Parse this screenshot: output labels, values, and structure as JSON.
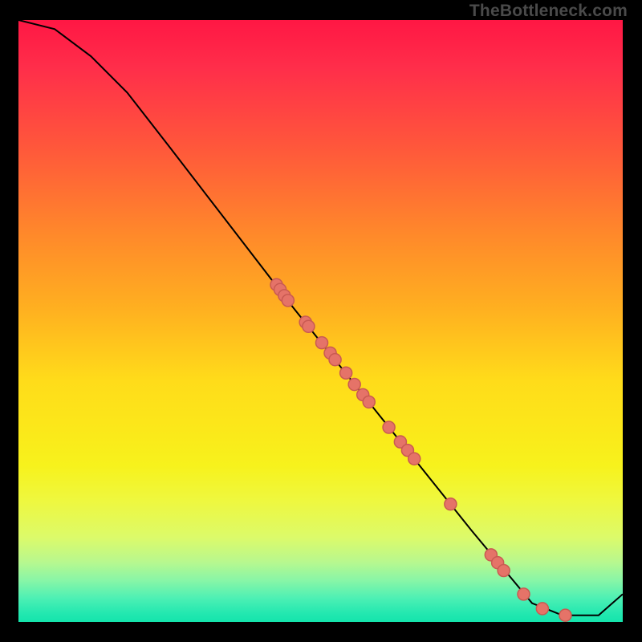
{
  "watermark": "TheBottleneck.com",
  "chart_data": {
    "type": "line",
    "title": "",
    "xlabel": "",
    "ylabel": "",
    "xlim": [
      0,
      100
    ],
    "ylim": [
      0,
      100
    ],
    "curve": [
      {
        "x": 0,
        "y": 100
      },
      {
        "x": 6,
        "y": 98.5
      },
      {
        "x": 12,
        "y": 94
      },
      {
        "x": 18,
        "y": 88
      },
      {
        "x": 25,
        "y": 79
      },
      {
        "x": 35,
        "y": 66
      },
      {
        "x": 45,
        "y": 53
      },
      {
        "x": 55,
        "y": 40.5
      },
      {
        "x": 65,
        "y": 28
      },
      {
        "x": 75,
        "y": 15.5
      },
      {
        "x": 85,
        "y": 3.5
      },
      {
        "x": 90,
        "y": 1.5
      },
      {
        "x": 96,
        "y": 1.5
      },
      {
        "x": 100,
        "y": 5
      }
    ],
    "points": [
      {
        "x": 42.7,
        "y": 56.2,
        "r": 5
      },
      {
        "x": 43.3,
        "y": 55.4,
        "r": 5
      },
      {
        "x": 44.0,
        "y": 54.4,
        "r": 5
      },
      {
        "x": 44.6,
        "y": 53.6,
        "r": 5
      },
      {
        "x": 47.5,
        "y": 50.0,
        "r": 5
      },
      {
        "x": 48.0,
        "y": 49.3,
        "r": 5
      },
      {
        "x": 50.2,
        "y": 46.6,
        "r": 5
      },
      {
        "x": 51.6,
        "y": 44.9,
        "r": 5
      },
      {
        "x": 52.4,
        "y": 43.8,
        "r": 5
      },
      {
        "x": 54.2,
        "y": 41.6,
        "r": 5
      },
      {
        "x": 55.6,
        "y": 39.7,
        "r": 5
      },
      {
        "x": 57.0,
        "y": 38.0,
        "r": 5
      },
      {
        "x": 58.0,
        "y": 36.8,
        "r": 5
      },
      {
        "x": 61.3,
        "y": 32.6,
        "r": 5
      },
      {
        "x": 63.2,
        "y": 30.2,
        "r": 5
      },
      {
        "x": 64.4,
        "y": 28.8,
        "r": 5
      },
      {
        "x": 65.5,
        "y": 27.4,
        "r": 5
      },
      {
        "x": 71.5,
        "y": 19.9,
        "r": 5
      },
      {
        "x": 78.2,
        "y": 11.5,
        "r": 5
      },
      {
        "x": 79.3,
        "y": 10.2,
        "r": 5
      },
      {
        "x": 80.3,
        "y": 8.9,
        "r": 5
      },
      {
        "x": 83.6,
        "y": 5.0,
        "r": 5
      },
      {
        "x": 86.7,
        "y": 2.6,
        "r": 5
      },
      {
        "x": 90.5,
        "y": 1.5,
        "r": 5
      }
    ],
    "colors": {
      "curve": "#000000",
      "point_fill": "#e57368",
      "point_stroke": "#c95a52"
    }
  }
}
